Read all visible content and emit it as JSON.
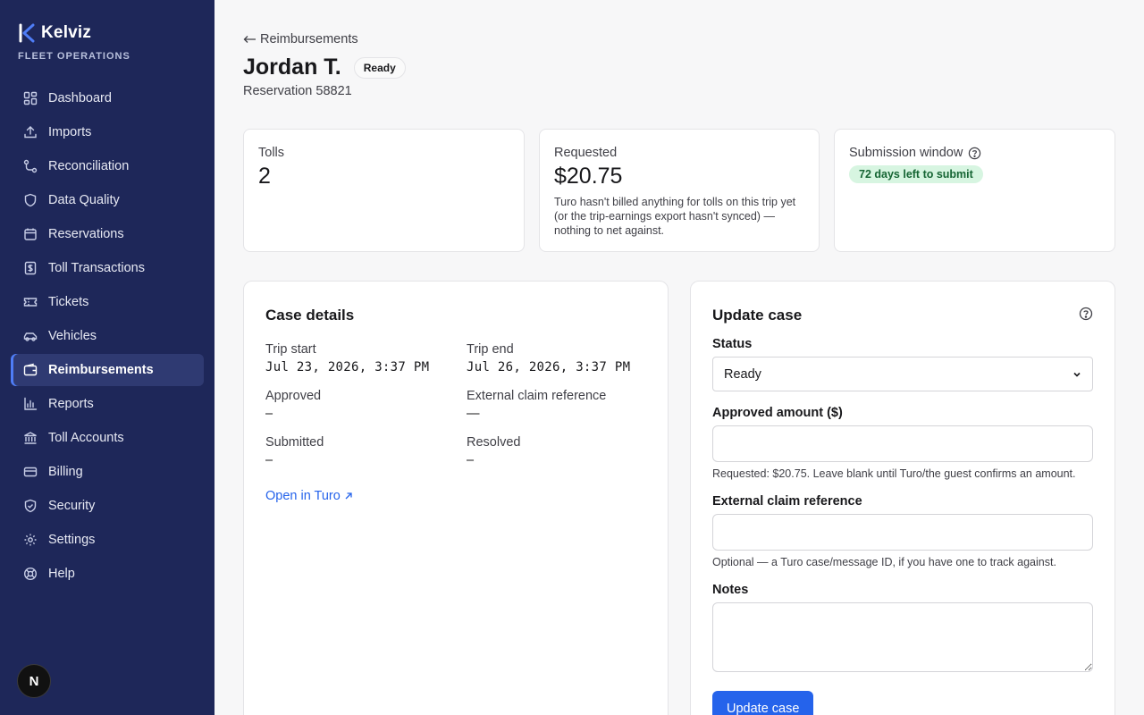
{
  "brand": {
    "name": "Kelviz",
    "subtitle": "FLEET OPERATIONS",
    "accent": "#4f7df6"
  },
  "sidebar": {
    "items": [
      {
        "label": "Dashboard",
        "icon": "dashboard-icon"
      },
      {
        "label": "Imports",
        "icon": "upload-icon"
      },
      {
        "label": "Reconciliation",
        "icon": "route-icon"
      },
      {
        "label": "Data Quality",
        "icon": "shield-icon"
      },
      {
        "label": "Reservations",
        "icon": "calendar-icon"
      },
      {
        "label": "Toll Transactions",
        "icon": "receipt-icon"
      },
      {
        "label": "Tickets",
        "icon": "ticket-icon"
      },
      {
        "label": "Vehicles",
        "icon": "car-icon"
      },
      {
        "label": "Reimbursements",
        "icon": "wallet-icon",
        "active": true
      },
      {
        "label": "Reports",
        "icon": "bar-chart-icon"
      },
      {
        "label": "Toll Accounts",
        "icon": "bank-icon"
      },
      {
        "label": "Billing",
        "icon": "credit-card-icon"
      },
      {
        "label": "Security",
        "icon": "shield-check-icon"
      },
      {
        "label": "Settings",
        "icon": "gear-icon"
      },
      {
        "label": "Help",
        "icon": "lifebuoy-icon"
      }
    ],
    "avatar_letter": "N"
  },
  "header": {
    "back_label": "Reimbursements",
    "title": "Jordan T.",
    "status": "Ready",
    "subtitle": "Reservation 58821"
  },
  "stats": {
    "tolls": {
      "label": "Tolls",
      "value": "2"
    },
    "requested": {
      "label": "Requested",
      "value": "$20.75",
      "note": "Turo hasn't billed anything for tolls on this trip yet (or the trip-earnings export hasn't synced) — nothing to net against."
    },
    "window": {
      "label": "Submission window",
      "badge": "72 days left to submit"
    }
  },
  "case_details": {
    "title": "Case details",
    "trip_start_label": "Trip start",
    "trip_start": "Jul 23, 2026, 3:37 PM",
    "trip_end_label": "Trip end",
    "trip_end": "Jul 26, 2026, 3:37 PM",
    "approved_label": "Approved",
    "approved": "–",
    "claim_ref_label": "External claim reference",
    "claim_ref": "—",
    "submitted_label": "Submitted",
    "submitted": "–",
    "resolved_label": "Resolved",
    "resolved": "–",
    "turo_link": "Open in Turo"
  },
  "update_case": {
    "title": "Update case",
    "status_label": "Status",
    "status_value": "Ready",
    "approved_label": "Approved amount ($)",
    "approved_value": "",
    "approved_hint": "Requested: $20.75. Leave blank until Turo/the guest confirms an amount.",
    "claim_label": "External claim reference",
    "claim_value": "",
    "claim_hint": "Optional — a Turo case/message ID, if you have one to track against.",
    "notes_label": "Notes",
    "notes_value": "",
    "submit_label": "Update case"
  }
}
